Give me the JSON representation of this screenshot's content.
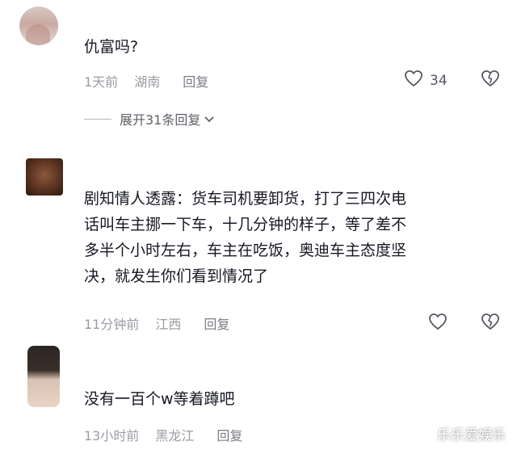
{
  "comments": [
    {
      "text": "仇富吗?",
      "time": "1天前",
      "location": "湖南",
      "reply": "回复",
      "likes": "34",
      "expand_replies": "展开31条回复"
    },
    {
      "text_lines": [
        "剧知情人透露：货车司机要卸货，打了三四次电",
        "话叫车主挪一下车，十几分钟的样子，等了差不",
        "多半个小时左右，车主在吃饭，奥迪车主态度坚",
        "决，就发生你们看到情况了"
      ],
      "time": "11分钟前",
      "location": "江西",
      "reply": "回复"
    },
    {
      "text": "没有一百个w等着蹲吧",
      "time": "13小时前",
      "location": "黑龙江",
      "reply": "回复"
    }
  ],
  "watermark": "乐乐爱娱乐",
  "icons": {
    "like": "heart-outline-icon",
    "dislike": "broken-heart-icon",
    "expand": "chevron-down-icon"
  },
  "colors": {
    "text": "#161823",
    "meta": "#9a9ca3"
  }
}
